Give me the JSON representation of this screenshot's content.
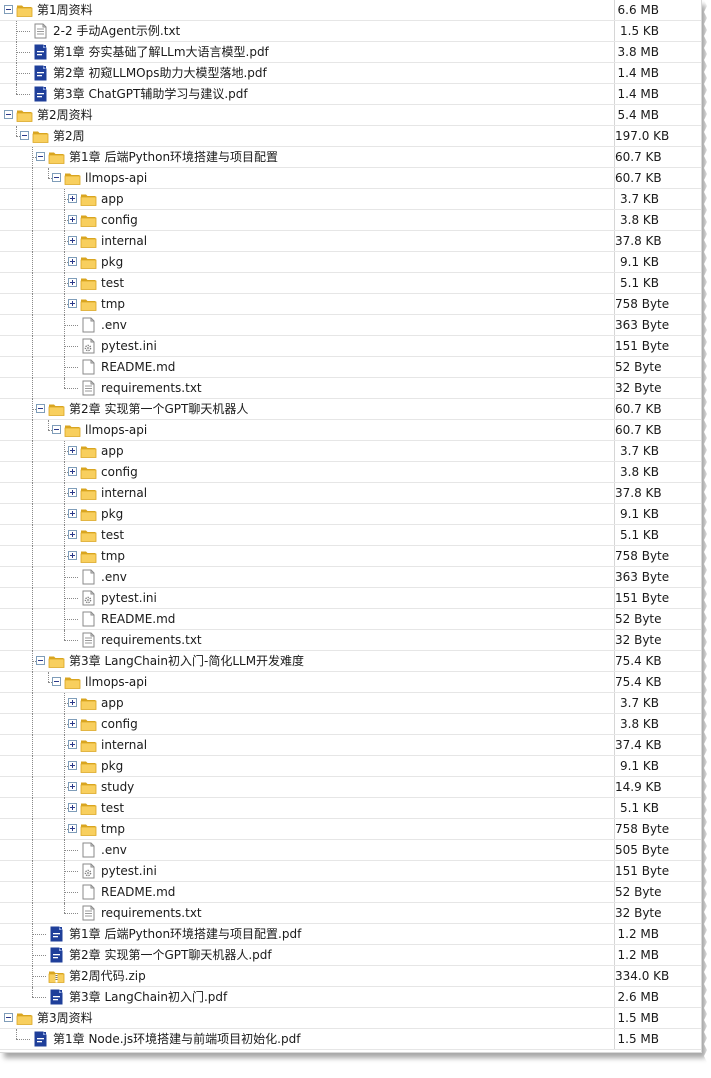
{
  "tree": [
    {
      "label": "第1周资料",
      "size": "6.6 MB",
      "type": "folder",
      "level": 0,
      "toggle": "open",
      "icon": "folder-icon"
    },
    {
      "label": "2-2 手动Agent示例.txt",
      "size": "1.5 KB",
      "type": "txt",
      "level": 1,
      "toggle": "none",
      "icon": "text-file-icon"
    },
    {
      "label": "第1章 夯实基础了解LLm大语言模型.pdf",
      "size": "3.8 MB",
      "type": "pdf",
      "level": 1,
      "toggle": "none",
      "icon": "pdf-file-icon"
    },
    {
      "label": "第2章 初窥LLMOps助力大模型落地.pdf",
      "size": "1.4 MB",
      "type": "pdf",
      "level": 1,
      "toggle": "none",
      "icon": "pdf-file-icon"
    },
    {
      "label": "第3章 ChatGPT辅助学习与建议.pdf",
      "size": "1.4 MB",
      "type": "pdf",
      "level": 1,
      "toggle": "none",
      "icon": "pdf-file-icon"
    },
    {
      "label": "第2周资料",
      "size": "5.4 MB",
      "type": "folder",
      "level": 0,
      "toggle": "open",
      "icon": "folder-icon"
    },
    {
      "label": "第2周",
      "size": "197.0 KB",
      "type": "folder",
      "level": 1,
      "toggle": "open",
      "icon": "folder-icon"
    },
    {
      "label": "第1章 后端Python环境搭建与项目配置",
      "size": "60.7 KB",
      "type": "folder",
      "level": 2,
      "toggle": "open",
      "icon": "folder-icon"
    },
    {
      "label": "llmops-api",
      "size": "60.7 KB",
      "type": "folder",
      "level": 3,
      "toggle": "open",
      "icon": "folder-icon"
    },
    {
      "label": "app",
      "size": "3.7 KB",
      "type": "folder",
      "level": 4,
      "toggle": "closed",
      "icon": "folder-icon"
    },
    {
      "label": "config",
      "size": "3.8 KB",
      "type": "folder",
      "level": 4,
      "toggle": "closed",
      "icon": "folder-icon"
    },
    {
      "label": "internal",
      "size": "37.8 KB",
      "type": "folder",
      "level": 4,
      "toggle": "closed",
      "icon": "folder-icon"
    },
    {
      "label": "pkg",
      "size": "9.1 KB",
      "type": "folder",
      "level": 4,
      "toggle": "closed",
      "icon": "folder-icon"
    },
    {
      "label": "test",
      "size": "5.1 KB",
      "type": "folder",
      "level": 4,
      "toggle": "closed",
      "icon": "folder-icon"
    },
    {
      "label": "tmp",
      "size": "758 Byte",
      "type": "folder",
      "level": 4,
      "toggle": "closed",
      "icon": "folder-icon"
    },
    {
      "label": ".env",
      "size": "363 Byte",
      "type": "blank",
      "level": 4,
      "toggle": "none",
      "icon": "blank-file-icon"
    },
    {
      "label": "pytest.ini",
      "size": "151 Byte",
      "type": "ini",
      "level": 4,
      "toggle": "none",
      "icon": "settings-file-icon"
    },
    {
      "label": "README.md",
      "size": "52 Byte",
      "type": "blank",
      "level": 4,
      "toggle": "none",
      "icon": "blank-file-icon"
    },
    {
      "label": "requirements.txt",
      "size": "32 Byte",
      "type": "txt",
      "level": 4,
      "toggle": "none",
      "icon": "text-file-icon"
    },
    {
      "label": "第2章 实现第一个GPT聊天机器人",
      "size": "60.7 KB",
      "type": "folder",
      "level": 2,
      "toggle": "open",
      "icon": "folder-icon"
    },
    {
      "label": "llmops-api",
      "size": "60.7 KB",
      "type": "folder",
      "level": 3,
      "toggle": "open",
      "icon": "folder-icon"
    },
    {
      "label": "app",
      "size": "3.7 KB",
      "type": "folder",
      "level": 4,
      "toggle": "closed",
      "icon": "folder-icon"
    },
    {
      "label": "config",
      "size": "3.8 KB",
      "type": "folder",
      "level": 4,
      "toggle": "closed",
      "icon": "folder-icon"
    },
    {
      "label": "internal",
      "size": "37.8 KB",
      "type": "folder",
      "level": 4,
      "toggle": "closed",
      "icon": "folder-icon"
    },
    {
      "label": "pkg",
      "size": "9.1 KB",
      "type": "folder",
      "level": 4,
      "toggle": "closed",
      "icon": "folder-icon"
    },
    {
      "label": "test",
      "size": "5.1 KB",
      "type": "folder",
      "level": 4,
      "toggle": "closed",
      "icon": "folder-icon"
    },
    {
      "label": "tmp",
      "size": "758 Byte",
      "type": "folder",
      "level": 4,
      "toggle": "closed",
      "icon": "folder-icon"
    },
    {
      "label": ".env",
      "size": "363 Byte",
      "type": "blank",
      "level": 4,
      "toggle": "none",
      "icon": "blank-file-icon"
    },
    {
      "label": "pytest.ini",
      "size": "151 Byte",
      "type": "ini",
      "level": 4,
      "toggle": "none",
      "icon": "settings-file-icon"
    },
    {
      "label": "README.md",
      "size": "52 Byte",
      "type": "blank",
      "level": 4,
      "toggle": "none",
      "icon": "blank-file-icon"
    },
    {
      "label": "requirements.txt",
      "size": "32 Byte",
      "type": "txt",
      "level": 4,
      "toggle": "none",
      "icon": "text-file-icon"
    },
    {
      "label": "第3章 LangChain初入门-简化LLM开发难度",
      "size": "75.4 KB",
      "type": "folder",
      "level": 2,
      "toggle": "open",
      "icon": "folder-icon"
    },
    {
      "label": "llmops-api",
      "size": "75.4 KB",
      "type": "folder",
      "level": 3,
      "toggle": "open",
      "icon": "folder-icon"
    },
    {
      "label": "app",
      "size": "3.7 KB",
      "type": "folder",
      "level": 4,
      "toggle": "closed",
      "icon": "folder-icon"
    },
    {
      "label": "config",
      "size": "3.8 KB",
      "type": "folder",
      "level": 4,
      "toggle": "closed",
      "icon": "folder-icon"
    },
    {
      "label": "internal",
      "size": "37.4 KB",
      "type": "folder",
      "level": 4,
      "toggle": "closed",
      "icon": "folder-icon"
    },
    {
      "label": "pkg",
      "size": "9.1 KB",
      "type": "folder",
      "level": 4,
      "toggle": "closed",
      "icon": "folder-icon"
    },
    {
      "label": "study",
      "size": "14.9 KB",
      "type": "folder",
      "level": 4,
      "toggle": "closed",
      "icon": "folder-icon"
    },
    {
      "label": "test",
      "size": "5.1 KB",
      "type": "folder",
      "level": 4,
      "toggle": "closed",
      "icon": "folder-icon"
    },
    {
      "label": "tmp",
      "size": "758 Byte",
      "type": "folder",
      "level": 4,
      "toggle": "closed",
      "icon": "folder-icon"
    },
    {
      "label": ".env",
      "size": "505 Byte",
      "type": "blank",
      "level": 4,
      "toggle": "none",
      "icon": "blank-file-icon"
    },
    {
      "label": "pytest.ini",
      "size": "151 Byte",
      "type": "ini",
      "level": 4,
      "toggle": "none",
      "icon": "settings-file-icon"
    },
    {
      "label": "README.md",
      "size": "52 Byte",
      "type": "blank",
      "level": 4,
      "toggle": "none",
      "icon": "blank-file-icon"
    },
    {
      "label": "requirements.txt",
      "size": "32 Byte",
      "type": "txt",
      "level": 4,
      "toggle": "none",
      "icon": "text-file-icon"
    },
    {
      "label": "第1章 后端Python环境搭建与项目配置.pdf",
      "size": "1.2 MB",
      "type": "pdf",
      "level": 2,
      "toggle": "none",
      "icon": "pdf-file-icon"
    },
    {
      "label": "第2章 实现第一个GPT聊天机器人.pdf",
      "size": "1.2 MB",
      "type": "pdf",
      "level": 2,
      "toggle": "none",
      "icon": "pdf-file-icon"
    },
    {
      "label": "第2周代码.zip",
      "size": "334.0 KB",
      "type": "zip",
      "level": 2,
      "toggle": "none",
      "icon": "zip-file-icon"
    },
    {
      "label": "第3章 LangChain初入门.pdf",
      "size": "2.6 MB",
      "type": "pdf",
      "level": 2,
      "toggle": "none",
      "icon": "pdf-file-icon"
    },
    {
      "label": "第3周资料",
      "size": "1.5 MB",
      "type": "folder",
      "level": 0,
      "toggle": "open",
      "icon": "folder-icon"
    },
    {
      "label": "第1章 Node.js环境搭建与前端项目初始化.pdf",
      "size": "1.5 MB",
      "type": "pdf",
      "level": 1,
      "toggle": "none",
      "icon": "pdf-file-icon"
    }
  ],
  "colors": {
    "folder_fill": "#f8cf5e",
    "folder_edge": "#d9a520",
    "pdf_blue": "#1f3f9a",
    "toggle_border": "#7f9db9",
    "grid_line": "#e6e6e6"
  }
}
